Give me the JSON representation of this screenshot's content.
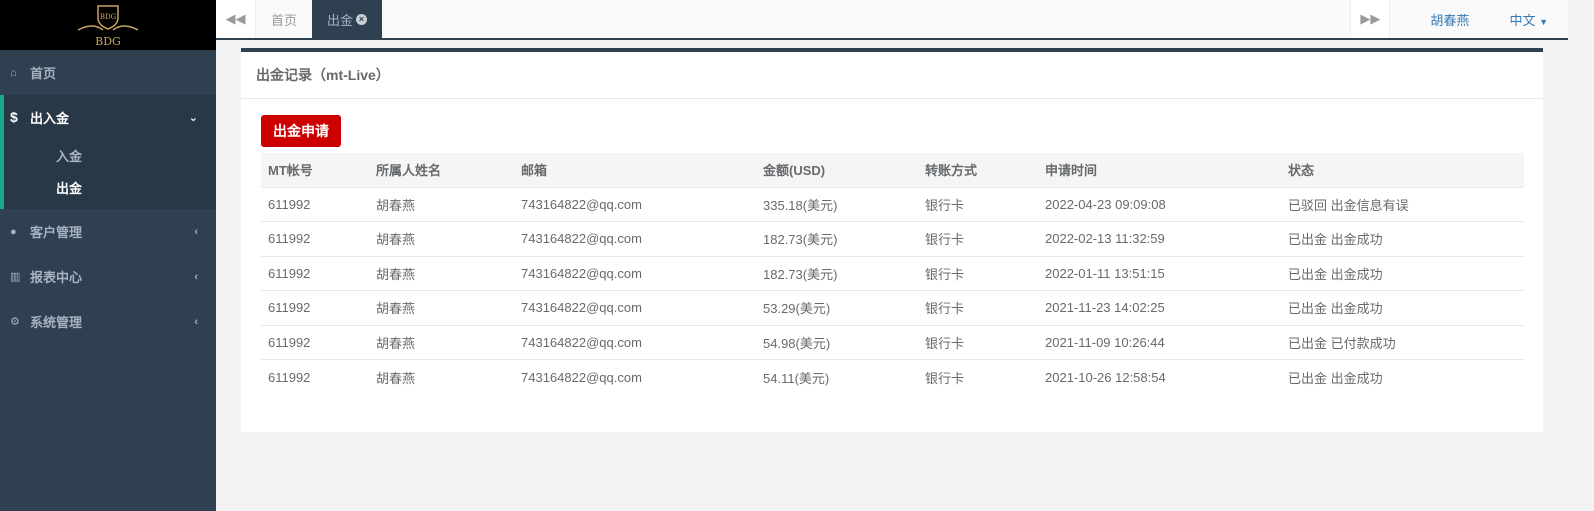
{
  "logo": {
    "text": "BDG"
  },
  "sidebar": {
    "home": "首页",
    "finance": "出入金",
    "deposit": "入金",
    "withdraw": "出金",
    "customers": "客户管理",
    "reports": "报表中心",
    "system": "系统管理"
  },
  "tabs": {
    "home": "首页",
    "withdraw": "出金"
  },
  "topbar": {
    "user": "胡春燕",
    "lang": "中文"
  },
  "panel": {
    "title": "出金记录（mt-Live）",
    "apply_button": "出金申请"
  },
  "table": {
    "headers": [
      "MT帐号",
      "所属人姓名",
      "邮箱",
      "金额(USD)",
      "转账方式",
      "申请时间",
      "状态"
    ],
    "rows": [
      [
        "611992",
        "胡春燕",
        "743164822@qq.com",
        "335.18(美元)",
        "银行卡",
        "2022-04-23 09:09:08",
        "已驳回 出金信息有误"
      ],
      [
        "611992",
        "胡春燕",
        "743164822@qq.com",
        "182.73(美元)",
        "银行卡",
        "2022-02-13 11:32:59",
        "已出金 出金成功"
      ],
      [
        "611992",
        "胡春燕",
        "743164822@qq.com",
        "182.73(美元)",
        "银行卡",
        "2022-01-11 13:51:15",
        "已出金 出金成功"
      ],
      [
        "611992",
        "胡春燕",
        "743164822@qq.com",
        "53.29(美元)",
        "银行卡",
        "2021-11-23 14:02:25",
        "已出金 出金成功"
      ],
      [
        "611992",
        "胡春燕",
        "743164822@qq.com",
        "54.98(美元)",
        "银行卡",
        "2021-11-09 10:26:44",
        "已出金 已付款成功"
      ],
      [
        "611992",
        "胡春燕",
        "743164822@qq.com",
        "54.11(美元)",
        "银行卡",
        "2021-10-26 12:58:54",
        "已出金 出金成功"
      ]
    ]
  }
}
